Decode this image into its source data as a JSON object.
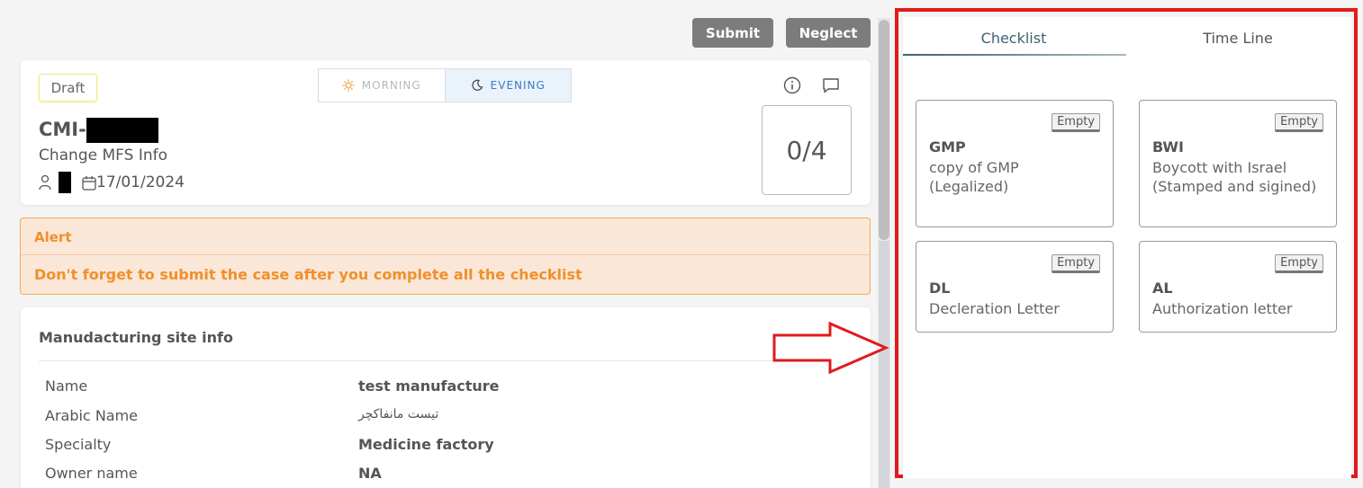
{
  "toolbar": {
    "submit_label": "Submit",
    "neglect_label": "Neglect"
  },
  "case": {
    "status": "Draft",
    "shift": {
      "morning": "MORNING",
      "evening": "EVENING",
      "selected": "EVENING"
    },
    "id_prefix": "CMI-",
    "type": "Change MFS Info",
    "date": "17/01/2024",
    "progress": "0/4"
  },
  "alert": {
    "title": "Alert",
    "message": "Don't forget to submit the case after you complete all the checklist"
  },
  "site_info": {
    "title": "Manudacturing site info",
    "rows": [
      {
        "label": "Name",
        "value": "test manufacture"
      },
      {
        "label": "Arabic Name",
        "value": "تيست مانفاكچر"
      },
      {
        "label": "Specialty",
        "value": "Medicine factory"
      },
      {
        "label": "Owner name",
        "value": "NA"
      }
    ]
  },
  "checklist_panel": {
    "tabs": [
      {
        "label": "Checklist",
        "active": true
      },
      {
        "label": "Time Line",
        "active": false
      }
    ],
    "items": [
      {
        "code": "GMP",
        "description": "copy of GMP (Legalized)",
        "status": "Empty"
      },
      {
        "code": "BWI",
        "description": "Boycott with Israel (Stamped and sigined)",
        "status": "Empty"
      },
      {
        "code": "DL",
        "description": "Decleration Letter",
        "status": "Empty"
      },
      {
        "code": "AL",
        "description": "Authorization letter",
        "status": "Empty"
      }
    ]
  },
  "colors": {
    "highlight_frame": "#e01b1b",
    "alert_text": "#f0902a",
    "accent": "#3a7bbf"
  },
  "icons": [
    "sun-icon",
    "moon-icon",
    "user-icon",
    "calendar-icon",
    "info-icon",
    "chat-icon",
    "arrow-right-icon"
  ]
}
